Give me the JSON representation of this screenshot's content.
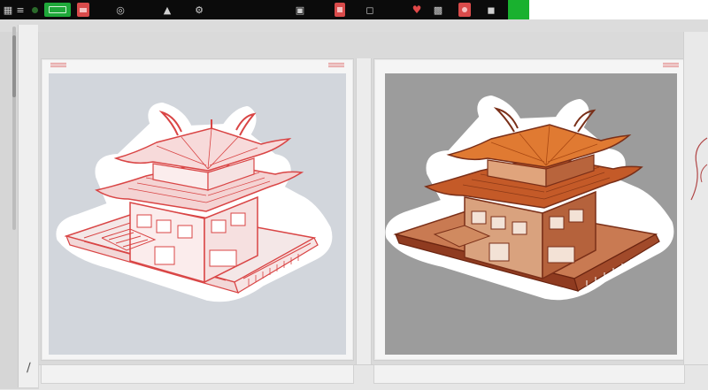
{
  "toolbar": {
    "icons": [
      "grid-icon",
      "paint-icon",
      "record-icon",
      "save-icon",
      "image-icon",
      "gamepad-icon",
      "pin-icon",
      "shield-icon",
      "fullscreen-icon",
      "layers-icon",
      "plus-icon",
      "heart-icon",
      "display-icon",
      "record-red-icon",
      "lock-icon"
    ],
    "colors": {
      "bar_bg": "#0b0b0b",
      "green": "#1fa83a",
      "red": "#d94b4b"
    }
  },
  "panels": {
    "left": {
      "name": "red-line-pagoda",
      "image_bg": "#d2d6dc"
    },
    "right": {
      "name": "orange-brown-pagoda",
      "image_bg": "#9c9c9c"
    }
  }
}
